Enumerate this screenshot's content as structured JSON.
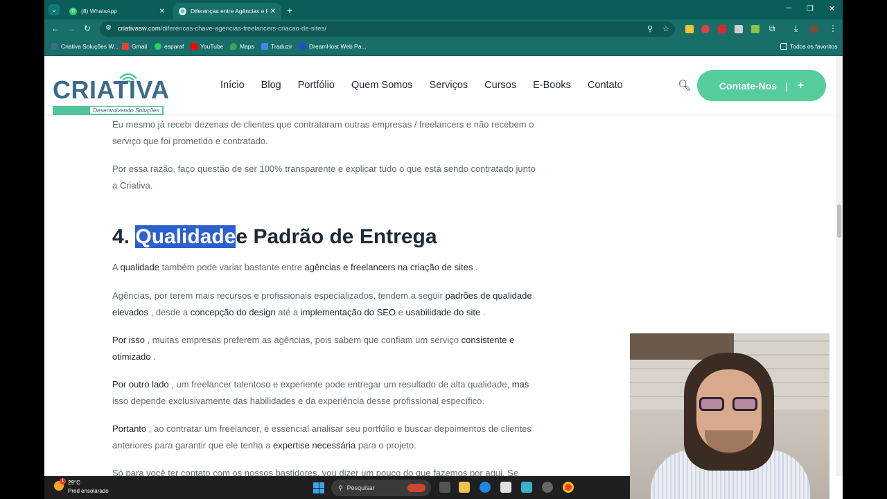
{
  "browser": {
    "tabs": [
      {
        "title": "(8) WhatsApp",
        "active": false
      },
      {
        "title": "Diferenças entre Agências e Fre",
        "active": true
      }
    ],
    "url_host": "criativasw.com",
    "url_path": "/diferencas-chave-agencias-freelancers-criacao-de-sites/",
    "bookmarks": [
      "Criativa Soluções W...",
      "Gmail",
      "esparaf",
      "YouTube",
      "Maps",
      "Traduzir",
      "DreamHost Web Pa...",
      "Todos os favoritos"
    ]
  },
  "site": {
    "logo_text": "CRIATIVA",
    "logo_tagline": "Desenvolvendo Soluções",
    "menu": [
      "Início",
      "Blog",
      "Portfólio",
      "Quem Somos",
      "Serviços",
      "Cursos",
      "E-Books",
      "Contato"
    ],
    "cta_label": "Contate-Nos",
    "cta_plus": "+"
  },
  "article": {
    "p1": "Eu mesmo já recebi dezenas de clientes que contrataram outras empresas / freelancers e não recebem o serviço que foi prometido e contratado.",
    "p2": "Por essa razão, faço questão de ser 100% transparente e explicar tudo o que está sendo contratado junto a Criativa.",
    "h2_num": "4.",
    "h2_selected": "Qualidade",
    "h2_rest": "e Padrão de Entrega",
    "p3": {
      "a": "A ",
      "b": "qualidade",
      "c": " também pode variar bastante entre ",
      "d": "agências e freelancers na criação de sites",
      "e": " ."
    },
    "p4": {
      "a": "Agências, por terem mais recursos e profissionais especializados, tendem a seguir ",
      "b": "padrões de qualidade elevados",
      "c": " , desde a ",
      "d": "concepção do design",
      "e": " até a ",
      "f": "implementação do SEO",
      "g": " e ",
      "h": "usabilidade do site",
      "i": " ."
    },
    "p5": {
      "a": "Por isso",
      "b": " , muitas empresas preferem as agências, pois sabem que confiam um serviço ",
      "c": "consistente e otimizado",
      "d": " ."
    },
    "p6": {
      "a": "Por outro lado",
      "b": " , um freelancer talentoso e experiente pode entregar um resultado de alta qualidade, ",
      "c": "mas",
      "d": " isso depende exclusivamente das habilidades e da experiência desse profissional específico."
    },
    "p7": {
      "a": "Portanto",
      "b": " , ao contratar um freelancer, é essencial analisar seu portfólio e buscar depoimentos de clientes anteriores para garantir que ele tenha a ",
      "c": "expertise necessária",
      "d": " para o projeto."
    },
    "p8": "Só para você ter contato com os nossos bastidores, vou dizer um pouco do que fazemos por aqui. Se"
  },
  "taskbar": {
    "temp": "29°C",
    "weather": "Pred ensolarado",
    "search_placeholder": "Pesquisar",
    "weather_badge": "1"
  }
}
